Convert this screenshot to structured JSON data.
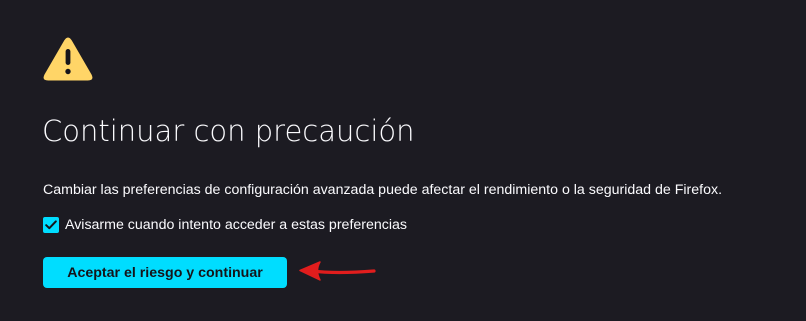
{
  "warning": {
    "icon": "warning-triangle-icon",
    "color": "#ffd567"
  },
  "title": "Continuar con precaución",
  "description": "Cambiar las preferencias de configuración avanzada puede afectar el rendimiento o la seguridad de Firefox.",
  "checkbox": {
    "label": "Avisarme cuando intento acceder a estas preferencias",
    "checked": true,
    "color": "#00ddff"
  },
  "accept_button": {
    "label": "Aceptar el riesgo y continuar",
    "color": "#00ddff"
  },
  "annotation": {
    "icon": "red-arrow-icon",
    "color": "#e11d1d"
  },
  "colors": {
    "background": "#1c1b22",
    "text": "#fbfbfe"
  }
}
